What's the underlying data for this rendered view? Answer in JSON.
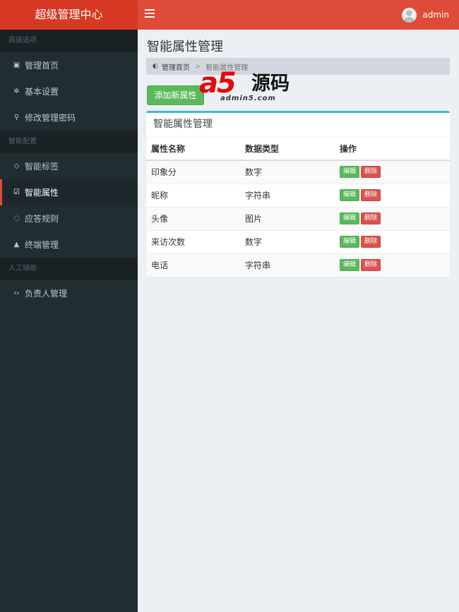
{
  "header": {
    "logo": "超级管理中心",
    "user_name": "admin"
  },
  "sidebar": {
    "sections": [
      {
        "title": "高级选项",
        "items": [
          {
            "label": "管理首页",
            "icon": "calendar-check-icon"
          },
          {
            "label": "基本设置",
            "icon": "gear-icon"
          },
          {
            "label": "修改管理密码",
            "icon": "key-icon"
          }
        ]
      },
      {
        "title": "智能配置",
        "items": [
          {
            "label": "智能标签",
            "icon": "diamond-icon"
          },
          {
            "label": "智能属性",
            "icon": "check-square-icon",
            "active": true
          },
          {
            "label": "应答规则",
            "icon": "comments-icon"
          },
          {
            "label": "终端管理",
            "icon": "graduation-cap-icon"
          }
        ]
      },
      {
        "title": "人工辅助",
        "items": [
          {
            "label": "负责人管理",
            "icon": "code-icon"
          }
        ]
      }
    ]
  },
  "page": {
    "title": "智能属性管理"
  },
  "breadcrumb": {
    "home": "管理首页",
    "separator": ">",
    "current": "智能属性管理"
  },
  "watermark": {
    "brand": "a5",
    "text": "源码",
    "url": "admin5.com"
  },
  "toolbar": {
    "add_label": "添加新属性"
  },
  "box": {
    "title": "智能属性管理",
    "columns": [
      "属性名称",
      "数据类型",
      "操作"
    ],
    "rows": [
      {
        "name": "印象分",
        "type": "数字"
      },
      {
        "name": "昵称",
        "type": "字符串"
      },
      {
        "name": "头像",
        "type": "图片"
      },
      {
        "name": "来访次数",
        "type": "数字"
      },
      {
        "name": "电话",
        "type": "字符串"
      }
    ],
    "edit_label": "编辑",
    "delete_label": "删除"
  },
  "colors": {
    "header": "#dd4b39",
    "logo_bg": "#d73925",
    "sidebar": "#222d32",
    "accent": "#3cbcd6",
    "success": "#5cb85c",
    "danger": "#d9534f"
  }
}
